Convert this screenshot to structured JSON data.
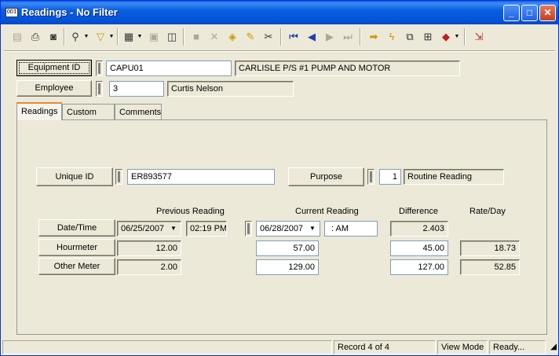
{
  "window": {
    "title": "Readings - No Filter",
    "icon_text": "ODI"
  },
  "title_buttons": {
    "minimize": "_",
    "maximize": "□",
    "close": "✕"
  },
  "header": {
    "equipment_id_label": "Equipment ID",
    "equipment_id_value": "CAPU01",
    "equipment_description": "CARLISLE P/S #1 PUMP AND MOTOR",
    "employee_label": "Employee",
    "employee_id_value": "3",
    "employee_name": "Curtis Nelson"
  },
  "tabs": [
    {
      "label": "Readings"
    },
    {
      "label": "Custom"
    },
    {
      "label": "Comments"
    }
  ],
  "readings": {
    "unique_id_label": "Unique ID",
    "unique_id_value": "ER893577",
    "purpose_label": "Purpose",
    "purpose_code": "1",
    "purpose_desc": "Routine Reading",
    "col_previous": "Previous Reading",
    "col_current": "Current Reading",
    "col_difference": "Difference",
    "col_rate": "Rate/Day",
    "datetime_label": "Date/Time",
    "prev_date": "06/25/2007",
    "prev_time": "02:19 PM",
    "cur_date": "06/28/2007",
    "cur_time": " :  AM",
    "date_difference": "2.403",
    "hourmeter_label": "Hourmeter",
    "hourmeter_prev": "12.00",
    "hourmeter_cur": "57.00",
    "hourmeter_diff": "45.00",
    "hourmeter_rate": "18.73",
    "othermeter_label": "Other Meter",
    "othermeter_prev": "2.00",
    "othermeter_cur": "129.00",
    "othermeter_diff": "127.00",
    "othermeter_rate": "52.85"
  },
  "status": {
    "record": "Record 4 of 4",
    "mode": "View Mode",
    "state": "Ready..."
  }
}
